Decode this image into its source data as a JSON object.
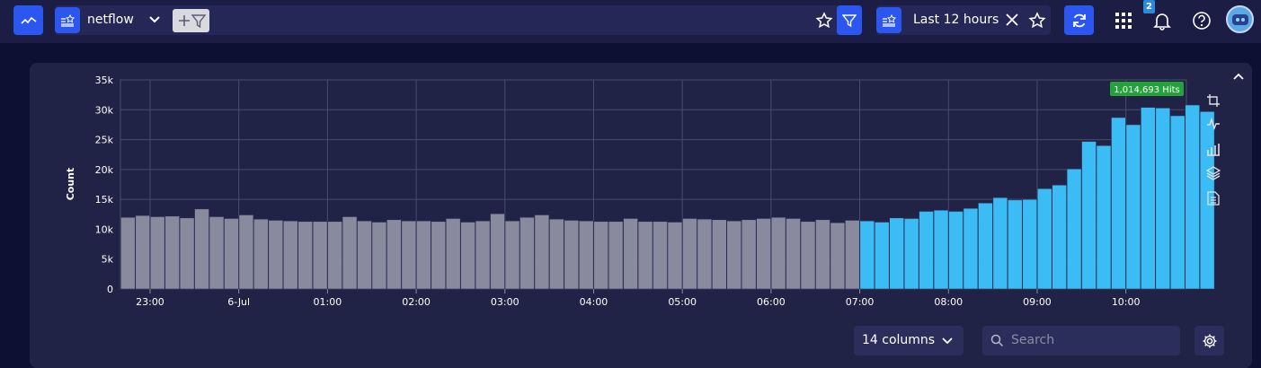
{
  "topbar": {
    "index_name": "netflow",
    "time_range": "Last 12 hours",
    "notification_count": "2"
  },
  "chart_data": {
    "type": "bar",
    "ylabel": "Count",
    "xlabel": "",
    "title": "",
    "ylim": [
      0,
      35000
    ],
    "yticks": [
      "0",
      "5k",
      "10k",
      "15k",
      "20k",
      "25k",
      "30k",
      "35k"
    ],
    "xticks": [
      "23:00",
      "6-Jul",
      "01:00",
      "02:00",
      "03:00",
      "04:00",
      "05:00",
      "06:00",
      "07:00",
      "08:00",
      "09:00",
      "10:00"
    ],
    "total_label": "1,014,693 Hits",
    "colors": {
      "past": "#898a9e",
      "recent": "#3bbcf4"
    },
    "highlight_start_index": 50,
    "values": [
      12000,
      12300,
      12100,
      12200,
      11900,
      13400,
      12100,
      11800,
      12400,
      11700,
      11500,
      11400,
      11300,
      11300,
      11300,
      12100,
      11400,
      11200,
      11600,
      11400,
      11400,
      11300,
      11800,
      11200,
      11400,
      12600,
      11400,
      12000,
      12400,
      11700,
      11500,
      11400,
      11300,
      11300,
      11800,
      11300,
      11300,
      11200,
      11800,
      11700,
      11600,
      11400,
      11600,
      11800,
      12000,
      11800,
      11300,
      11600,
      11100,
      11500,
      11400,
      11200,
      11900,
      11800,
      13000,
      13200,
      13000,
      13500,
      14400,
      15300,
      14900,
      15000,
      16800,
      17400,
      20100,
      24700,
      24000,
      28700,
      27500,
      30400,
      30300,
      29000,
      30800,
      29700
    ]
  },
  "footer": {
    "columns_label": "14 columns",
    "search_placeholder": "Search"
  }
}
